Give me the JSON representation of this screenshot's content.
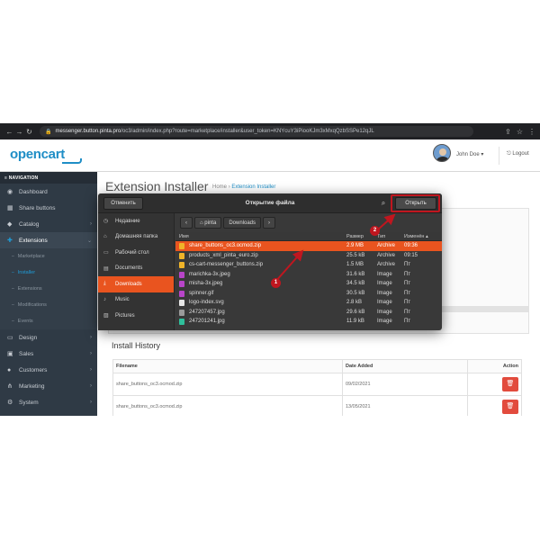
{
  "browser": {
    "url_host": "messenger.button.pinta.pro",
    "url_path": "/oc3/admin/index.php?route=marketplace/installer&user_token=KNYcuY3iPiooKJm3xMxqQzbSSPe12qJL"
  },
  "header": {
    "logo": "opencart",
    "user_name": "John Doe",
    "logout": "Logout"
  },
  "sidebar": {
    "heading": "NAVIGATION",
    "items": [
      {
        "label": "Dashboard",
        "icon": "dashboard-icon"
      },
      {
        "label": "Share buttons",
        "icon": "share-icon"
      },
      {
        "label": "Catalog",
        "icon": "tag-icon"
      },
      {
        "label": "Extensions",
        "icon": "puzzle-icon"
      },
      {
        "label": "Design",
        "icon": "monitor-icon"
      },
      {
        "label": "Sales",
        "icon": "cart-icon"
      },
      {
        "label": "Customers",
        "icon": "user-icon"
      },
      {
        "label": "Marketing",
        "icon": "share-icon"
      },
      {
        "label": "System",
        "icon": "gear-icon"
      }
    ],
    "subitems": [
      "Marketplace",
      "Installer",
      "Extensions",
      "Modifications",
      "Events"
    ]
  },
  "main": {
    "title": "Extension Installer",
    "breadcrumb_home": "Home",
    "breadcrumb_current": "Extension Installer",
    "history_title": "Install History",
    "table_headers": [
      "Filename",
      "Date Added",
      "Action"
    ],
    "table_rows": [
      {
        "filename": "share_buttons_oc3.ocmod.zip",
        "date": "09/02/2021"
      },
      {
        "filename": "share_buttons_oc3.ocmod.zip",
        "date": "13/05/2021"
      }
    ]
  },
  "dialog": {
    "cancel": "Отменить",
    "title": "Открытие файла",
    "open": "Открыть",
    "places": [
      "Недавние",
      "Домашняя папка",
      "Рабочий стол",
      "Documents",
      "Downloads",
      "Music",
      "Pictures"
    ],
    "selected_place": "Downloads",
    "path": [
      "pinta",
      "Downloads"
    ],
    "columns": [
      "Имя",
      "Размер",
      "Тип",
      "Изменён"
    ],
    "files": [
      {
        "name": "share_buttons_oc3.ocmod.zip",
        "size": "2.9 MB",
        "type": "Archive",
        "modified": "09:36",
        "kind": "zip",
        "selected": true
      },
      {
        "name": "products_xml_pinta_euro.zip",
        "size": "25.5 kB",
        "type": "Archive",
        "modified": "09:15",
        "kind": "zip"
      },
      {
        "name": "cs-cart-messenger_buttons.zip",
        "size": "1.5 MB",
        "type": "Archive",
        "modified": "Пт",
        "kind": "zip"
      },
      {
        "name": "marichka-3x.jpeg",
        "size": "31.6 kB",
        "type": "Image",
        "modified": "Пт",
        "kind": "img"
      },
      {
        "name": "misha-3x.jpeg",
        "size": "34.5 kB",
        "type": "Image",
        "modified": "Пт",
        "kind": "img"
      },
      {
        "name": "spinner.gif",
        "size": "30.5 kB",
        "type": "Image",
        "modified": "Пт",
        "kind": "img"
      },
      {
        "name": "logo-index.svg",
        "size": "2.8 kB",
        "type": "Image",
        "modified": "Пт",
        "kind": "svg"
      },
      {
        "name": "247207457.jpg",
        "size": "29.6 kB",
        "type": "Image",
        "modified": "Пт",
        "kind": "jpg"
      },
      {
        "name": "247201241.jpg",
        "size": "11.9 kB",
        "type": "Image",
        "modified": "Пт",
        "kind": "jpg2"
      }
    ]
  },
  "annotations": {
    "step1": "1",
    "step2": "2",
    "color": "#c0161f"
  }
}
